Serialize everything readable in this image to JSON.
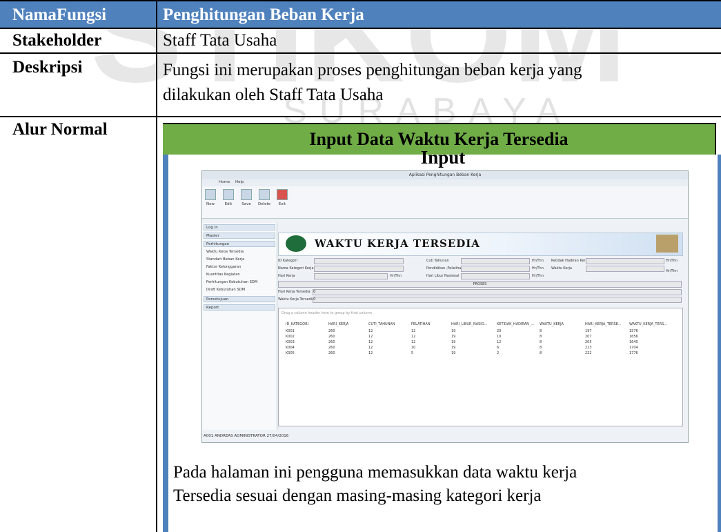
{
  "table": {
    "header_left": "NamaFungsi",
    "header_right": "Penghitungan Beban Kerja",
    "stakeholder_label": "Stakeholder",
    "stakeholder_value": "Staff Tata Usaha",
    "deskripsi_label": "Deskripsi",
    "deskripsi_line1": "Fungsi ini merupakan proses penghitungan beban kerja yang",
    "deskripsi_line2": "dilakukan oleh Staff Tata Usaha",
    "alur_label": "Alur Normal",
    "flow_title": "Input Data Waktu Kerja Tersedia",
    "input_title": "Input",
    "bottom_line1": "Pada halaman ini pengguna memasukkan data waktu kerja",
    "bottom_line2": "Tersedia sesuai dengan masing-masing kategori kerja"
  },
  "watermark": {
    "big": "STIKOM",
    "small": "SURABAYA"
  },
  "app": {
    "window_title": "Aplikasi Penghitungan Beban Kerja",
    "tabs": [
      "Home",
      "Help"
    ],
    "ribbon": [
      "New",
      "Edit",
      "Save",
      "Delete",
      "Exit"
    ],
    "ribbon_groups": [
      "New",
      "Edit",
      "S...",
      "D...",
      "Exit"
    ],
    "side_sections": [
      "Log In",
      "Master",
      "Perhitungan",
      "Persetujuan",
      "Report"
    ],
    "side_items": [
      "Waktu Kerja Tersedia",
      "Standart Beban Kerja",
      "Faktor Kelonggaran",
      "Kuantitas Kegiatan",
      "Perhitungan Kebutuhan SDM",
      "Draft Kebutuhan SDM"
    ],
    "banner_title": "WAKTU KERJA TERSEDIA",
    "form": {
      "id_kategori": "ID Kategori",
      "nama_kategori": "Nama Kategori Kerja",
      "hari_kerja": "Hari Kerja",
      "cuti_tahunan": "Cuti Tahunan",
      "pendidikan": "Pendidikan ,Pelatihan",
      "hari_libur": "Hari Libur Nasional",
      "ketidak_hadiran": "Ketidak Hadiran Kerja",
      "waktu_kerja": "Waktu Kerja",
      "unit": "Hr/Thn",
      "proses": "PROSES",
      "hari_kerja_tersedia": "Hari Kerja Tersedia",
      "waktu_kerja_tersedia": "Waktu Kerja Tersedia",
      "zero": "0"
    },
    "grid_hint": "Drag a column header here to group by that column",
    "columns": [
      "ID_KATEGORI",
      "HARI_KERJA",
      "CUTI_TAHUNAN",
      "PELATIHAN",
      "HARI_LIBUR_NASIO...",
      "KETIDAK_HADIRAN_...",
      "WAKTU_KERJA",
      "HARI_KERJA_TERSE...",
      "WAKTU_KERJA_TERS..."
    ],
    "rows": [
      [
        "K001",
        "260",
        "12",
        "12",
        "19",
        "20",
        "8",
        "197",
        "1576"
      ],
      [
        "K002",
        "260",
        "12",
        "12",
        "19",
        "10",
        "8",
        "207",
        "1656"
      ],
      [
        "K003",
        "260",
        "12",
        "12",
        "19",
        "12",
        "8",
        "205",
        "1640"
      ],
      [
        "K004",
        "260",
        "12",
        "10",
        "19",
        "6",
        "8",
        "213",
        "1704"
      ],
      [
        "K005",
        "260",
        "12",
        "5",
        "19",
        "2",
        "8",
        "222",
        "1776"
      ]
    ],
    "status": "A001 ANDREAS ADMINISTRATOR 27/04/2016"
  }
}
